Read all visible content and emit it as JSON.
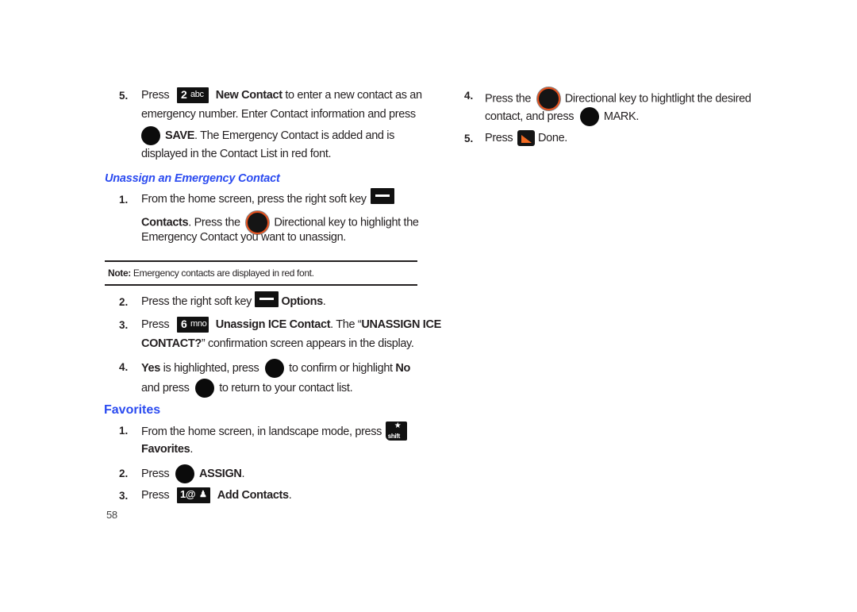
{
  "left_column": {
    "step5": {
      "num": "5.",
      "line1_pre": "Press",
      "key_icon": "2-abc-key-icon",
      "key_digit": "2",
      "key_letters": "abc",
      "line1_bold": "New Contact",
      "line1_post": " to enter a new contact as an",
      "line2": "emergency number. Enter Contact information and press",
      "line3_bold": "SAVE",
      "line3_post": ". The Emergency Contact is added and is",
      "line4": "displayed in the Contact List in red font."
    },
    "unassign_heading": "Unassign an Emergency Contact",
    "unassign_steps": {
      "s1": {
        "num": "1.",
        "line1": "From the home screen, press the right soft key",
        "line2_bold": "Contacts",
        "line2_mid": ". Press the",
        "line2_post": "Directional key to highlight the",
        "line3": "Emergency Contact you want to unassign."
      },
      "note_label": "Note:",
      "note_text": " Emergency contacts are displayed in red font.",
      "s2": {
        "num": "2.",
        "pre": "Press the right soft key",
        "bold": "Options",
        "post": "."
      },
      "s3": {
        "num": "3.",
        "pre": "Press",
        "key_digit": "6",
        "key_letters": "mno",
        "bold1": "Unassign ICE Contact",
        "mid": ". The “",
        "bold2": "UNASSIGN ICE",
        "line2_bold": "CONTACT?",
        "line2_post": "” confirmation screen appears in the display."
      },
      "s4": {
        "num": "4.",
        "bold1": "Yes",
        "mid1": " is highlighted, press",
        "mid2": "to confirm or highlight",
        "bold2": "No",
        "line2_pre": "and press",
        "line2_post": "to return to your contact list."
      }
    },
    "favorites_heading": "Favorites",
    "favorites_steps": {
      "s1": {
        "num": "1.",
        "line1": "From the home screen, in landscape mode, press",
        "shift_label": "shift",
        "line2_bold": "Favorites",
        "line2_post": "."
      },
      "s2": {
        "num": "2.",
        "pre": "Press",
        "bold": "ASSIGN",
        "post": "."
      },
      "s3": {
        "num": "3.",
        "pre": "Press",
        "key_label": "1@",
        "bold": "Add Contacts",
        "post": "."
      }
    },
    "page_number": "58"
  },
  "right_column": {
    "s4": {
      "num": "4.",
      "pre": "Press the",
      "post": "Directional key to hightlight the desired",
      "line2_pre": "contact, and press",
      "line2_post": "MARK."
    },
    "s5": {
      "num": "5.",
      "pre": "Press",
      "post": "Done."
    }
  },
  "colors": {
    "heading_blue": "#2b4bf0",
    "directional_ring": "#e8501c",
    "back_key_accent": "#f26a22",
    "text": "#231f20"
  }
}
